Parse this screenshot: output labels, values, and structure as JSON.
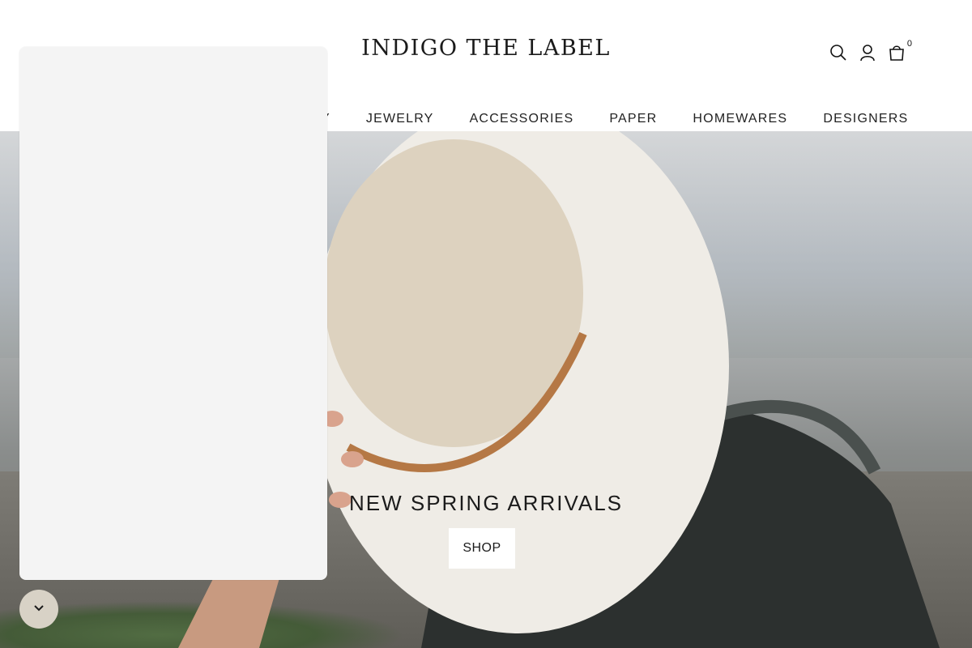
{
  "header": {
    "logo": "INDIGO THE LABEL",
    "cart_count": "0",
    "icons": [
      "search-icon",
      "account-icon",
      "cart-icon"
    ]
  },
  "nav": {
    "items": [
      {
        "label": "Y"
      },
      {
        "label": "JEWELRY"
      },
      {
        "label": "ACCESSORIES"
      },
      {
        "label": "PAPER"
      },
      {
        "label": "HOMEWARES"
      },
      {
        "label": "DESIGNERS"
      }
    ]
  },
  "hero": {
    "title": "NEW SPRING ARRIVALS",
    "button_label": "SHOP"
  },
  "widget": {
    "toggle_icon": "chevron-down-icon",
    "toggle_color": "#d8d2c6",
    "panel_color": "#f4f4f4"
  }
}
